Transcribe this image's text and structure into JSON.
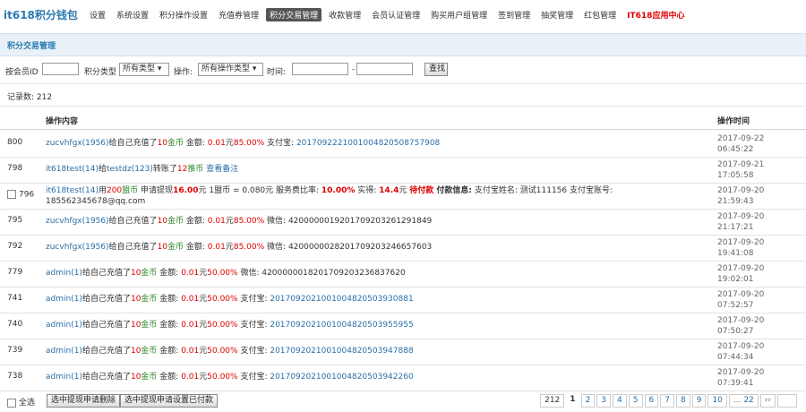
{
  "app": {
    "title": "it618积分钱包"
  },
  "nav": [
    {
      "label": "设置"
    },
    {
      "label": "系统设置"
    },
    {
      "label": "积分操作设置"
    },
    {
      "label": "充值券管理"
    },
    {
      "label": "积分交易管理",
      "active": true
    },
    {
      "label": "收款管理"
    },
    {
      "label": "会员认证管理"
    },
    {
      "label": "购买用户组管理"
    },
    {
      "label": "签到管理"
    },
    {
      "label": "抽奖管理"
    },
    {
      "label": "红包管理"
    },
    {
      "label": "IT618应用中心",
      "hot": true
    }
  ],
  "section_title": "积分交易管理",
  "filters": {
    "member_id_label": "按会员ID",
    "type_label": "积分类型",
    "type_value": "所有类型 ▾",
    "op_label": "操作:",
    "op_value": "所有操作类型 ▾",
    "time_label": "时间:",
    "dash": "-",
    "search_label": "查找"
  },
  "record_count": "记录数: 212",
  "columns": {
    "content": "操作内容",
    "time": "操作时间"
  },
  "rows": [
    {
      "id": "800",
      "segs": [
        {
          "t": "zucvhfgx(1956)",
          "c": "blue"
        },
        {
          "t": "给自己充值了"
        },
        {
          "t": "10",
          "c": "red"
        },
        {
          "t": "金币",
          "c": "green"
        },
        {
          "t": " 金额: "
        },
        {
          "t": "0.01",
          "c": "red"
        },
        {
          "t": "元"
        },
        {
          "t": "85.00%",
          "c": "red"
        },
        {
          "t": " 支付宝: "
        },
        {
          "t": "2017092221001004820508757908",
          "c": "blue"
        }
      ],
      "date": "2017-09-22",
      "clock": "06:45:22"
    },
    {
      "id": "798",
      "segs": [
        {
          "t": "it618test(14)",
          "c": "blue"
        },
        {
          "t": "给"
        },
        {
          "t": "testdz(123)",
          "c": "blue"
        },
        {
          "t": "转账了"
        },
        {
          "t": "12",
          "c": "red"
        },
        {
          "t": "推币",
          "c": "green"
        },
        {
          "t": " 查看备注",
          "c": "blue"
        }
      ],
      "date": "2017-09-21",
      "clock": "17:05:58"
    },
    {
      "id": "796",
      "checkbox": true,
      "segs": [
        {
          "t": "it618test(14)",
          "c": "blue"
        },
        {
          "t": "用"
        },
        {
          "t": "200",
          "c": "red"
        },
        {
          "t": "盟币",
          "c": "green"
        },
        {
          "t": " 申请提现"
        },
        {
          "t": "16.00",
          "c": "red bold"
        },
        {
          "t": "元 1盟币 = 0.080元 服务费比率: "
        },
        {
          "t": "10.00%",
          "c": "red bold"
        },
        {
          "t": " 实得: "
        },
        {
          "t": "14.4",
          "c": "red bold"
        },
        {
          "t": "元 "
        },
        {
          "t": "待付款",
          "c": "red bold"
        },
        {
          "t": " 付款信息:",
          "c": "bold"
        },
        {
          "t": " 支付宝姓名: 测试111156 支付宝账号: 185562345678@qq.com"
        }
      ],
      "date": "2017-09-20",
      "clock": "21:59:43"
    },
    {
      "id": "795",
      "segs": [
        {
          "t": "zucvhfgx(1956)",
          "c": "blue"
        },
        {
          "t": "给自己充值了"
        },
        {
          "t": "10",
          "c": "red"
        },
        {
          "t": "金币",
          "c": "green"
        },
        {
          "t": " 金额: "
        },
        {
          "t": "0.01",
          "c": "red"
        },
        {
          "t": "元"
        },
        {
          "t": "85.00%",
          "c": "red"
        },
        {
          "t": " 微信: 4200000019201709203261291849"
        }
      ],
      "date": "2017-09-20",
      "clock": "21:17:21"
    },
    {
      "id": "792",
      "segs": [
        {
          "t": "zucvhfgx(1956)",
          "c": "blue"
        },
        {
          "t": "给自己充值了"
        },
        {
          "t": "10",
          "c": "red"
        },
        {
          "t": "金币",
          "c": "green"
        },
        {
          "t": " 金额: "
        },
        {
          "t": "0.01",
          "c": "red"
        },
        {
          "t": "元"
        },
        {
          "t": "85.00%",
          "c": "red"
        },
        {
          "t": " 微信: 4200000028201709203246657603"
        }
      ],
      "date": "2017-09-20",
      "clock": "19:41:08"
    },
    {
      "id": "779",
      "segs": [
        {
          "t": "admin(1)",
          "c": "blue"
        },
        {
          "t": "给自己充值了"
        },
        {
          "t": "10",
          "c": "red"
        },
        {
          "t": "金币",
          "c": "green"
        },
        {
          "t": " 金额: "
        },
        {
          "t": "0.01",
          "c": "red"
        },
        {
          "t": "元"
        },
        {
          "t": "50.00%",
          "c": "red"
        },
        {
          "t": " 微信: 4200000018201709203236837620"
        }
      ],
      "date": "2017-09-20",
      "clock": "19:02:01"
    },
    {
      "id": "741",
      "segs": [
        {
          "t": "admin(1)",
          "c": "blue"
        },
        {
          "t": "给自己充值了"
        },
        {
          "t": "10",
          "c": "red"
        },
        {
          "t": "金币",
          "c": "green"
        },
        {
          "t": " 金额: "
        },
        {
          "t": "0.01",
          "c": "red"
        },
        {
          "t": "元"
        },
        {
          "t": "50.00%",
          "c": "red"
        },
        {
          "t": " 支付宝: "
        },
        {
          "t": "2017092021001004820503930881",
          "c": "blue"
        }
      ],
      "date": "2017-09-20",
      "clock": "07:52:57"
    },
    {
      "id": "740",
      "segs": [
        {
          "t": "admin(1)",
          "c": "blue"
        },
        {
          "t": "给自己充值了"
        },
        {
          "t": "10",
          "c": "red"
        },
        {
          "t": "金币",
          "c": "green"
        },
        {
          "t": " 金额: "
        },
        {
          "t": "0.01",
          "c": "red"
        },
        {
          "t": "元"
        },
        {
          "t": "50.00%",
          "c": "red"
        },
        {
          "t": " 支付宝: "
        },
        {
          "t": "2017092021001004820503955955",
          "c": "blue"
        }
      ],
      "date": "2017-09-20",
      "clock": "07:50:27"
    },
    {
      "id": "739",
      "segs": [
        {
          "t": "admin(1)",
          "c": "blue"
        },
        {
          "t": "给自己充值了"
        },
        {
          "t": "10",
          "c": "red"
        },
        {
          "t": "金币",
          "c": "green"
        },
        {
          "t": " 金额: "
        },
        {
          "t": "0.01",
          "c": "red"
        },
        {
          "t": "元"
        },
        {
          "t": "50.00%",
          "c": "red"
        },
        {
          "t": " 支付宝: "
        },
        {
          "t": "2017092021001004820503947888",
          "c": "blue"
        }
      ],
      "date": "2017-09-20",
      "clock": "07:44:34"
    },
    {
      "id": "738",
      "segs": [
        {
          "t": "admin(1)",
          "c": "blue"
        },
        {
          "t": "给自己充值了"
        },
        {
          "t": "10",
          "c": "red"
        },
        {
          "t": "金币",
          "c": "green"
        },
        {
          "t": " 金额: "
        },
        {
          "t": "0.01",
          "c": "red"
        },
        {
          "t": "元"
        },
        {
          "t": "50.00%",
          "c": "red"
        },
        {
          "t": " 支付宝: "
        },
        {
          "t": "2017092021001004820503942260",
          "c": "blue"
        }
      ],
      "date": "2017-09-20",
      "clock": "07:39:41"
    }
  ],
  "bottom": {
    "select_all": "全选",
    "delete_btn": "选中提现申请删除",
    "paid_btn": "选中提现申请设置已付款"
  },
  "pager": {
    "total": "212",
    "pages": [
      "1",
      "2",
      "3",
      "4",
      "5",
      "6",
      "7",
      "8",
      "9",
      "10",
      "... 22",
      "››"
    ],
    "current": "1"
  }
}
